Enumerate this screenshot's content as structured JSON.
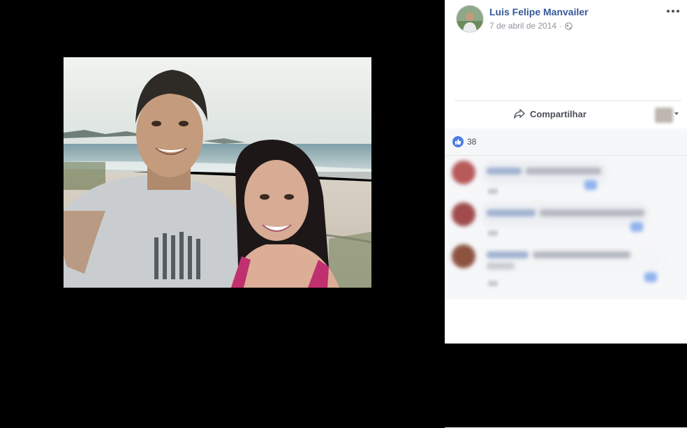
{
  "post": {
    "author_name": "Luis Felipe Manvailer",
    "date": "7 de abril de 2014",
    "date_separator": "·",
    "privacy_icon": "globe-icon",
    "more_icon": "more-options-icon"
  },
  "actions": {
    "share_label": "Compartilhar",
    "share_icon": "share-arrow-icon"
  },
  "reactions": {
    "like_count": "38",
    "like_icon": "thumbs-up-icon",
    "like_color": "#4a7ee3"
  },
  "photo": {
    "description_icon": "photo"
  },
  "colors": {
    "author_link": "#365899",
    "meta_gray": "#90949c",
    "panel_bg": "#f6f7f9"
  }
}
